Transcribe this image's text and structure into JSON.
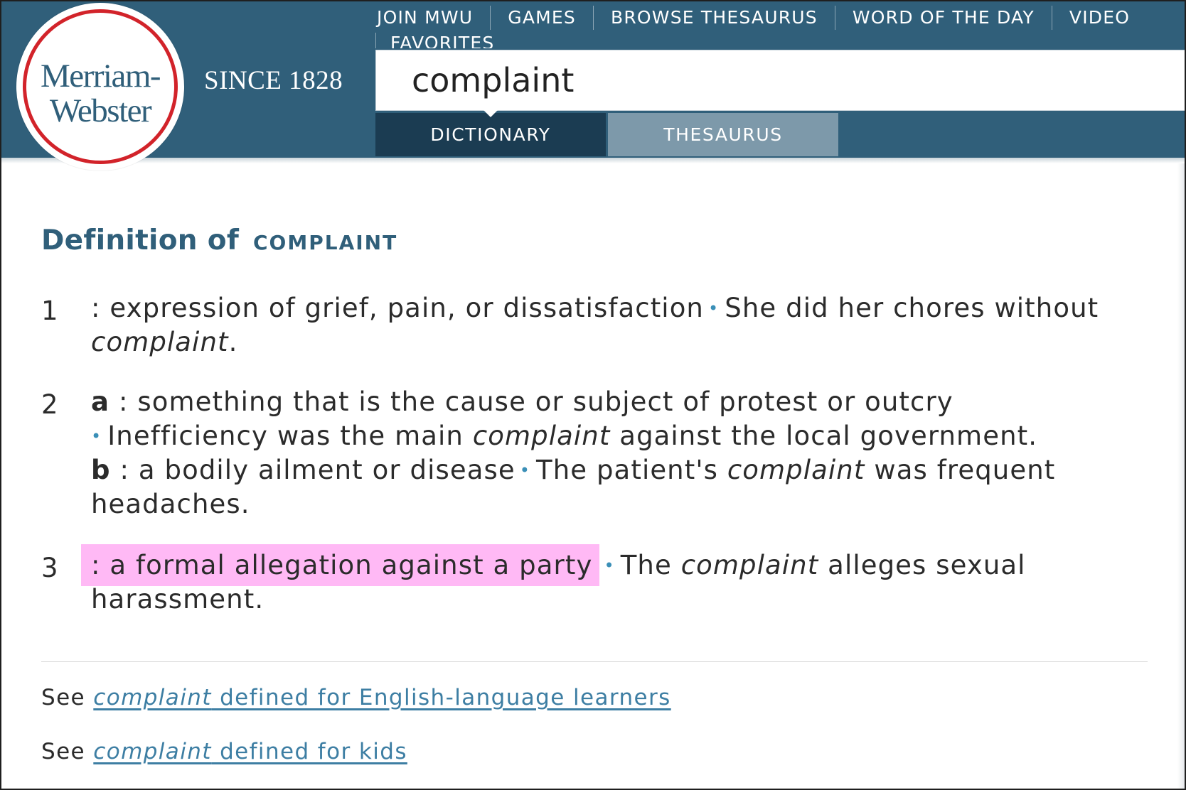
{
  "logo": {
    "line1": "Merriam-",
    "line2": "Webster",
    "tagline": "SINCE 1828"
  },
  "nav": {
    "items": [
      "JOIN MWU",
      "GAMES",
      "BROWSE THESAURUS",
      "WORD OF THE DAY",
      "VIDEO"
    ],
    "overflow_item": "FAVORITES"
  },
  "search": {
    "value": "complaint"
  },
  "tabs": {
    "dictionary": "DICTIONARY",
    "thesaurus": "THESAURUS",
    "active": "DICTIONARY"
  },
  "definition": {
    "heading": "Definition of",
    "word": "COMPLAINT",
    "senses": [
      {
        "number": "1",
        "text": ": expression of grief, pain, or dissatisfaction",
        "example_pre": "She did her chores without ",
        "example_word": "complaint",
        "example_post": "."
      },
      {
        "number": "2",
        "sub": [
          {
            "letter": "a",
            "text": " : something that is the cause or subject of protest or outcry",
            "example_pre": "Inefficiency was the main ",
            "example_word": "complaint",
            "example_post": " against the local government."
          },
          {
            "letter": "b",
            "text": " : a bodily ailment or disease",
            "example_pre": "The patient's ",
            "example_word": "complaint",
            "example_post": " was frequent headaches."
          }
        ]
      },
      {
        "number": "3",
        "text": ": a formal allegation against a party",
        "highlighted": true,
        "example_pre": "The ",
        "example_word": "complaint",
        "example_post": " alleges sexual harassment."
      }
    ]
  },
  "see_also": [
    {
      "prefix": "See",
      "link_word": "complaint",
      "link_rest": " defined for English-language learners"
    },
    {
      "prefix": "See",
      "link_word": "complaint",
      "link_rest": " defined for kids"
    }
  ],
  "colors": {
    "header_bg": "#305f7a",
    "tab_active": "#1b3c52",
    "tab_inactive": "#7d99aa",
    "logo_ring": "#d2232a",
    "bullet": "#3a8fb7",
    "highlight": "#ffb9f5",
    "link": "#3d7ea3"
  }
}
